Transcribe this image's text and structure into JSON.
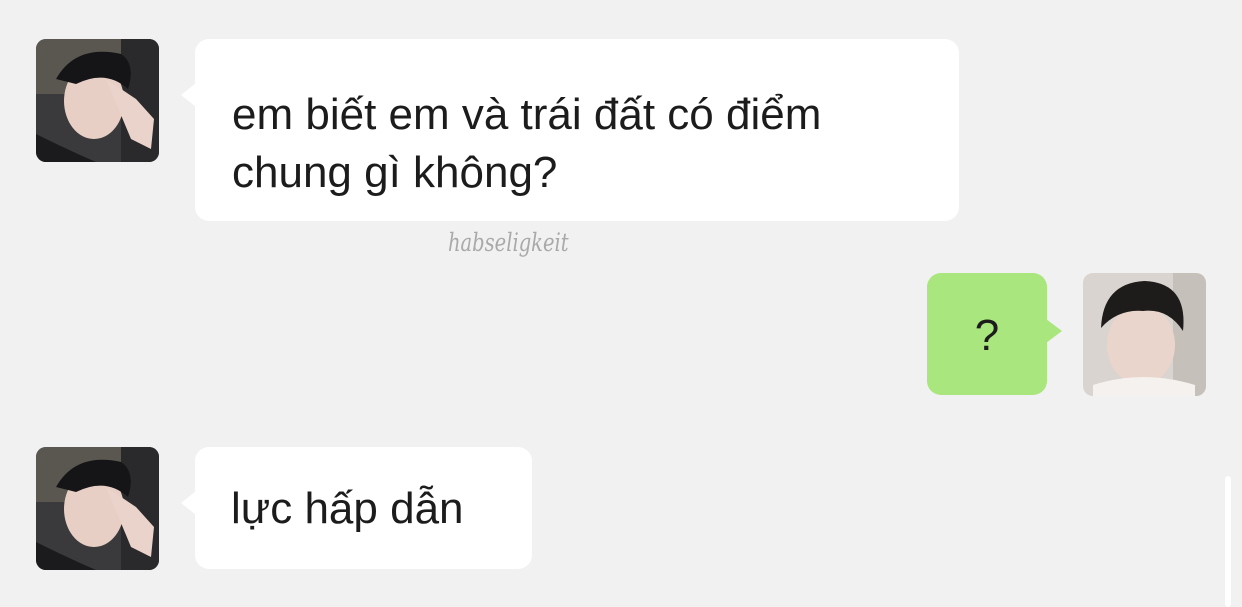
{
  "messages": [
    {
      "sender": "other",
      "text": "em biết em và trái đất có điểm chung gì không?",
      "avatar": "boy-hand-over-face-avatar"
    },
    {
      "sender": "self",
      "text": "?",
      "avatar": "boy-portrait-avatar"
    },
    {
      "sender": "other",
      "text": "lực hấp dẫn",
      "avatar": "boy-hand-over-face-avatar"
    }
  ],
  "watermark": "habseligkeit",
  "colors": {
    "background": "#f1f1f1",
    "incoming_bubble": "#ffffff",
    "outgoing_bubble": "#a9e67d",
    "text": "#1c1c1c"
  }
}
